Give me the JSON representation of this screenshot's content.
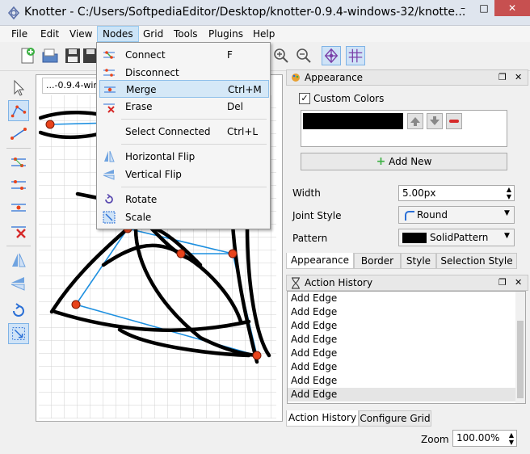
{
  "window": {
    "title": "Knotter - C:/Users/SoftpediaEditor/Desktop/knotter-0.9.4-windows-32/knotte..."
  },
  "menubar": [
    "File",
    "Edit",
    "View",
    "Nodes",
    "Grid",
    "Tools",
    "Plugins",
    "Help"
  ],
  "nodes_menu": {
    "items": [
      {
        "label": "Connect",
        "shortcut": "F"
      },
      {
        "label": "Disconnect",
        "shortcut": ""
      },
      {
        "label": "Merge",
        "shortcut": "Ctrl+M"
      },
      {
        "label": "Erase",
        "shortcut": "Del"
      },
      {
        "label": "Select Connected",
        "shortcut": "Ctrl+L"
      },
      {
        "label": "Horizontal Flip",
        "shortcut": ""
      },
      {
        "label": "Vertical Flip",
        "shortcut": ""
      },
      {
        "label": "Rotate",
        "shortcut": ""
      },
      {
        "label": "Scale",
        "shortcut": ""
      }
    ]
  },
  "document_tab": "...-0.9.4-win",
  "appearance": {
    "title": "Appearance",
    "custom_colors_label": "Custom Colors",
    "add_new_label": "Add New",
    "width_label": "Width",
    "width_value": "5.00px",
    "joint_style_label": "Joint Style",
    "joint_style_value": "Round",
    "pattern_label": "Pattern",
    "pattern_value": "SolidPattern",
    "tabs": [
      "Appearance",
      "Border",
      "Style",
      "Selection Style"
    ]
  },
  "history": {
    "title": "Action History",
    "items": [
      "Add Edge",
      "Add Edge",
      "Add Edge",
      "Add Edge",
      "Add Edge",
      "Add Edge",
      "Add Edge",
      "Add Edge"
    ],
    "tabs": [
      "Action History",
      "Configure Grid"
    ]
  },
  "status": {
    "zoom_label": "Zoom",
    "zoom_value": "100.00%"
  },
  "colors": {
    "accent": "#cce4f7",
    "node": "#e8431b",
    "edge": "#1e90e0",
    "knot": "#000000"
  }
}
